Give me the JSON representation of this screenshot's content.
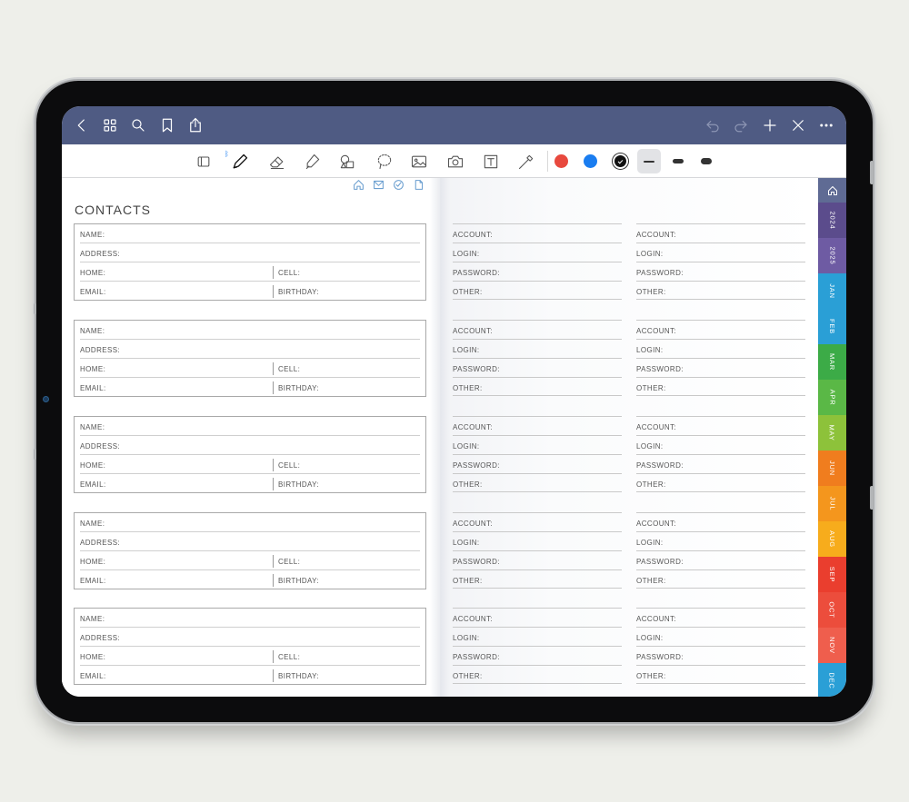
{
  "left_page": {
    "title": "CONTACTS",
    "labels": {
      "name": "NAME:",
      "address": "ADDRESS:",
      "home": "HOME:",
      "cell": "CELL:",
      "email": "EMAIL:",
      "birthday": "BIRTHDAY:"
    }
  },
  "right_page": {
    "labels": {
      "account": "ACCOUNT:",
      "login": "LOGIN:",
      "password": "PASSWORD:",
      "other": "OTHER:"
    }
  },
  "toolbar": {
    "colors": [
      "#e8493e",
      "#1a7df0",
      "#111111"
    ],
    "selected_color_index": 2,
    "selected_thickness_index": 0
  },
  "navbar": {
    "left_icons": [
      "back-icon",
      "grid-icon",
      "search-icon",
      "bookmark-icon",
      "share-icon"
    ],
    "right_icons": [
      "undo-icon",
      "redo-icon",
      "add-icon",
      "close-icon",
      "more-icon"
    ]
  },
  "page_icons": [
    "home-icon",
    "mail-icon",
    "check-circle-icon",
    "document-icon"
  ],
  "side_tabs": [
    {
      "label": "",
      "icon": "home-icon",
      "color": "#5f6b94"
    },
    {
      "label": "2024",
      "color": "#5b4c8c"
    },
    {
      "label": "2025",
      "color": "#6e5ba3"
    },
    {
      "label": "JAN",
      "color": "#2a9fd6"
    },
    {
      "label": "FEB",
      "color": "#2a9fd6"
    },
    {
      "label": "MAR",
      "color": "#3cab47"
    },
    {
      "label": "APR",
      "color": "#5ab846"
    },
    {
      "label": "MAY",
      "color": "#8dc23a"
    },
    {
      "label": "JUN",
      "color": "#f07d1e"
    },
    {
      "label": "JUL",
      "color": "#f4961d"
    },
    {
      "label": "AUG",
      "color": "#f7ac1c"
    },
    {
      "label": "SEP",
      "color": "#ea3e2e"
    },
    {
      "label": "OCT",
      "color": "#ec4d3c"
    },
    {
      "label": "NOV",
      "color": "#ef5e4d"
    },
    {
      "label": "DEC",
      "color": "#2a9fd6"
    }
  ]
}
